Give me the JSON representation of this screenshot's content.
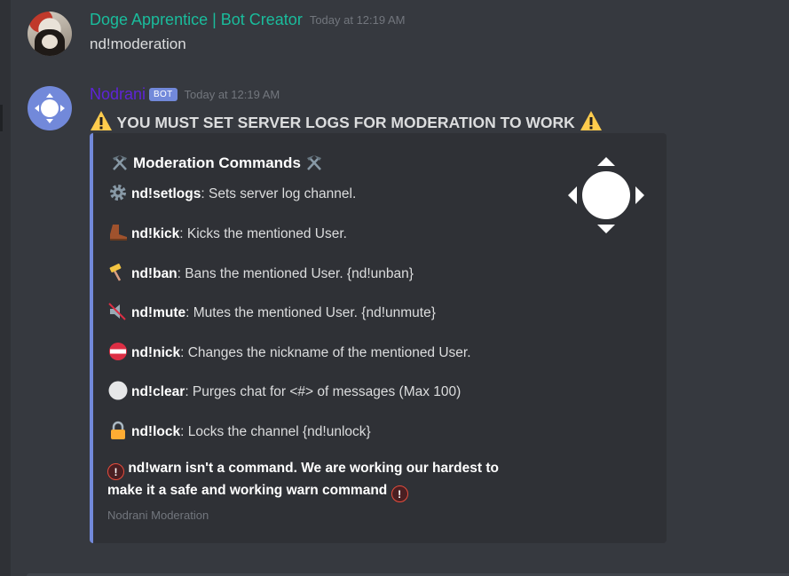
{
  "messages": [
    {
      "username": "Doge Apprentice | Bot Creator",
      "timestamp": "Today at 12:19 AM",
      "text": "nd!moderation"
    },
    {
      "username": "Nodrani",
      "bot_tag": "BOT",
      "timestamp": "Today at 12:19 AM",
      "warning": "YOU MUST SET SERVER LOGS FOR MODERATION TO WORK",
      "embed": {
        "title": "Moderation Commands",
        "fields": [
          {
            "icon": "gear-icon",
            "command": "nd!setlogs",
            "desc": ": Sets server log channel."
          },
          {
            "icon": "boot-icon",
            "command": "nd!kick",
            "desc": ": Kicks the mentioned User."
          },
          {
            "icon": "hammer-icon",
            "command": "nd!ban",
            "desc": ": Bans the mentioned User. {nd!unban}"
          },
          {
            "icon": "muted-speaker-icon",
            "command": "nd!mute",
            "desc": ": Mutes the mentioned User. {nd!unmute}"
          },
          {
            "icon": "name-badge-icon",
            "command": "nd!nick",
            "desc": ": Changes the nickname of the mentioned User."
          },
          {
            "icon": "white-circle-icon",
            "command": "nd!clear",
            "desc": ": Purges chat for <#> of messages (Max 100)"
          },
          {
            "icon": "lock-icon",
            "command": "nd!lock",
            "desc": ": Locks the channel {nd!unlock}"
          }
        ],
        "notice_line1": "nd!warn isn't a command. We are working our hardest to",
        "notice_line2": "make it a safe and working warn command",
        "notice_symbol": "!",
        "footer": "Nodrani Moderation"
      }
    }
  ],
  "colors": {
    "background": "#36393f",
    "embed_bg": "#2f3136",
    "embed_border": "#7289da",
    "username_user": "#1abc9c",
    "username_bot": "#5e24d8",
    "bot_tag": "#7289da"
  }
}
